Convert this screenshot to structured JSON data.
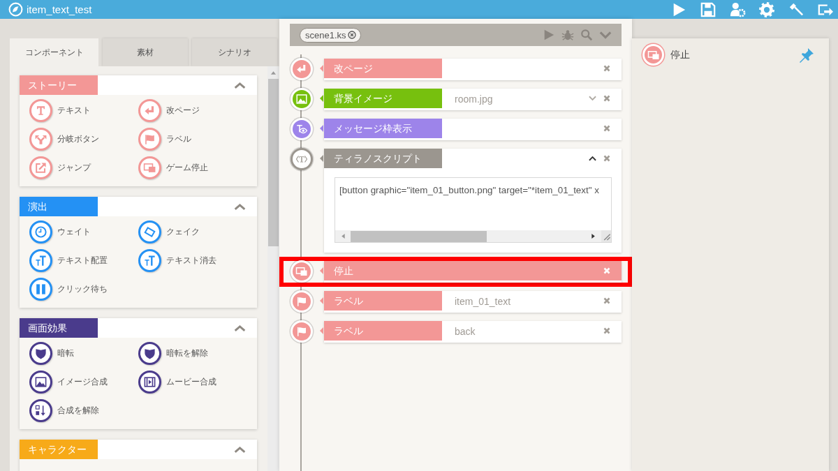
{
  "window": {
    "title": "item_text_test"
  },
  "tabs": [
    {
      "label": "コンポーネント",
      "selected": true
    },
    {
      "label": "素材",
      "selected": false
    },
    {
      "label": "シナリオ",
      "selected": false
    }
  ],
  "categories": [
    {
      "title": "ストーリー",
      "color": "#f39796",
      "expanded": true,
      "items": [
        {
          "label": "テキスト"
        },
        {
          "label": "改ページ"
        },
        {
          "label": "分岐ボタン"
        },
        {
          "label": "ラベル"
        },
        {
          "label": "ジャンプ"
        },
        {
          "label": "ゲーム停止"
        }
      ]
    },
    {
      "title": "演出",
      "color": "#2491f4",
      "expanded": true,
      "items": [
        {
          "label": "ウェイト"
        },
        {
          "label": "クェイク"
        },
        {
          "label": "テキスト配置"
        },
        {
          "label": "テキスト消去"
        },
        {
          "label": "クリック待ち"
        }
      ]
    },
    {
      "title": "画面効果",
      "color": "#4a3b8c",
      "expanded": true,
      "items": [
        {
          "label": "暗転"
        },
        {
          "label": "暗転を解除"
        },
        {
          "label": "イメージ合成"
        },
        {
          "label": "ムービー合成"
        },
        {
          "label": "合成を解除"
        }
      ]
    },
    {
      "title": "キャラクター",
      "color": "#f7aa19",
      "expanded": true
    }
  ],
  "scene": {
    "file_tab": "scene1.ks"
  },
  "timeline": [
    {
      "kind": "tag",
      "label": "改ページ",
      "color": "#f39796",
      "dropdown": false,
      "selected": false
    },
    {
      "kind": "tag",
      "label": "背景イメージ",
      "color": "#77c00e",
      "value": "room.jpg",
      "dropdown": true,
      "selected": false
    },
    {
      "kind": "tag",
      "label": "メッセージ枠表示",
      "color": "#9d84ea",
      "dropdown": false,
      "selected": false
    },
    {
      "kind": "script",
      "label": "ティラノスクリプト",
      "color": "#9b968f",
      "expanded": true,
      "code": "[button graphic=\"item_01_button.png\" target=\"*item_01_text\" x",
      "selected": false
    },
    {
      "kind": "tag",
      "label": "停止",
      "color": "#f39796",
      "dropdown": false,
      "selected": true
    },
    {
      "kind": "tag",
      "label": "ラベル",
      "color": "#f39796",
      "value": "item_01_text",
      "dropdown": false,
      "selected": false
    },
    {
      "kind": "tag",
      "label": "ラベル",
      "color": "#f39796",
      "value": "back",
      "dropdown": false,
      "selected": false
    }
  ],
  "inspector": {
    "label": "停止"
  }
}
